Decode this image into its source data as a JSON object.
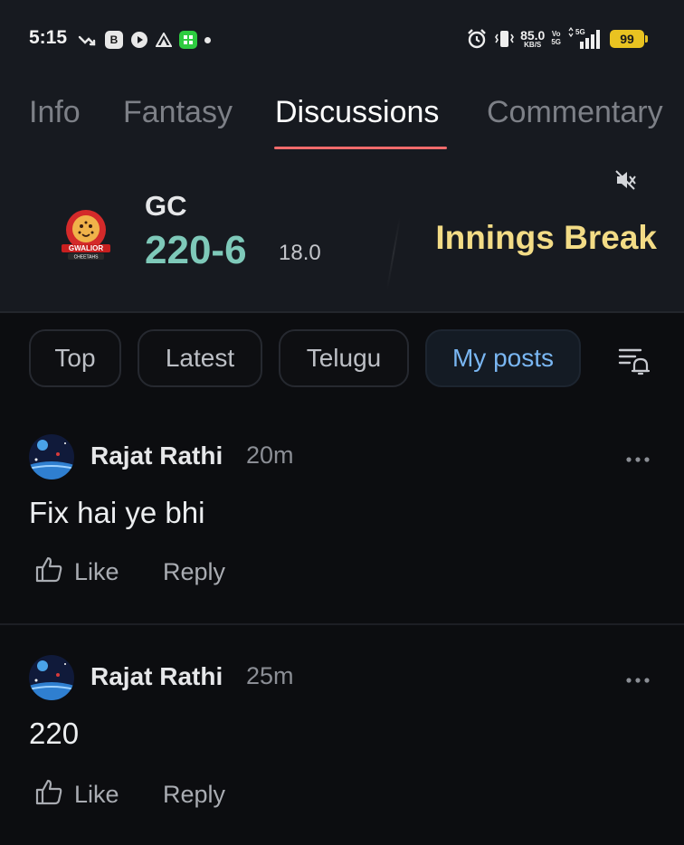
{
  "status_bar": {
    "time": "5:15",
    "badge_b": "B",
    "net_speed_value": "85.0",
    "net_speed_unit": "KB/S",
    "volte_top": "Vo",
    "volte_bottom": "5G",
    "network_type": "5G",
    "battery": "99",
    "icons": [
      "missed-call-icon",
      "b-app-icon",
      "play-icon",
      "triangle-app-icon",
      "green-app-icon",
      "dot-icon",
      "alarm-icon",
      "vibrate-icon",
      "signal-icon"
    ]
  },
  "tabs": [
    {
      "label": "Info",
      "active": false
    },
    {
      "label": "Fantasy",
      "active": false
    },
    {
      "label": "Discussions",
      "active": true
    },
    {
      "label": "Commentary",
      "active": false
    }
  ],
  "match": {
    "team_code": "GC",
    "logo_text_top": "GWALIOR",
    "logo_text_bottom": "CHEETAHS",
    "score": "220-6",
    "overs": "18.0",
    "status": "Innings Break",
    "colors": {
      "score": "#7ec9b9",
      "status": "#f3dc86"
    }
  },
  "filters": [
    {
      "label": "Top",
      "active": false
    },
    {
      "label": "Latest",
      "active": false
    },
    {
      "label": "Telugu",
      "active": false
    },
    {
      "label": "My posts",
      "active": true
    }
  ],
  "posts": [
    {
      "author": "Rajat Rathi",
      "time": "20m",
      "text": "Fix hai ye bhi",
      "like_label": "Like",
      "reply_label": "Reply"
    },
    {
      "author": "Rajat Rathi",
      "time": "25m",
      "text": "220",
      "like_label": "Like",
      "reply_label": "Reply"
    }
  ],
  "accent_colors": {
    "tab_underline": "#f16b6b",
    "active_chip_text": "#79b6f2"
  }
}
